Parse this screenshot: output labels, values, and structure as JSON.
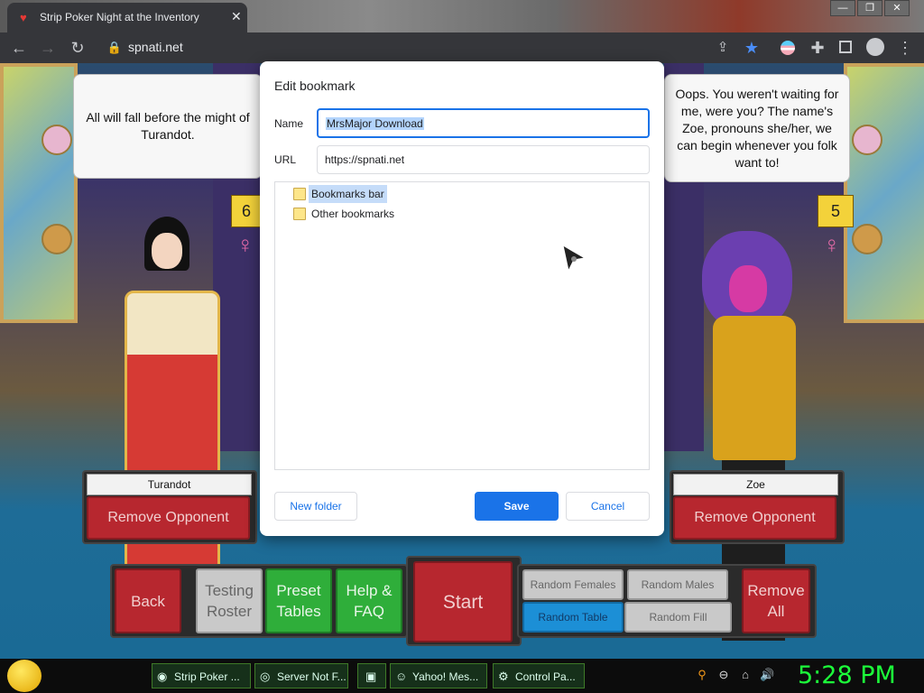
{
  "browser": {
    "tab_title": "Strip Poker Night at the Inventory",
    "tab_close": "✕",
    "url": "spnati.net",
    "window_controls": [
      "—",
      "❐",
      "✕"
    ]
  },
  "game": {
    "left_speech": "All will fall before the might of Turandot.",
    "right_speech": "Oops. You weren't waiting for me, were you? The name's Zoe, pronouns she/her, we can begin whenever you folk want to!",
    "left_badge": "6",
    "right_badge": "5",
    "left_name": "Turandot",
    "right_name": "Zoe",
    "remove_opponent": "Remove Opponent",
    "buttons": {
      "back": "Back",
      "testing_roster": "Testing Roster",
      "preset_tables": "Preset Tables",
      "help_faq": "Help & FAQ",
      "start": "Start",
      "random_females": "Random Females",
      "random_males": "Random Males",
      "random_table": "Random Table",
      "random_fill": "Random Fill",
      "remove_all": "Remove All"
    }
  },
  "dialog": {
    "title": "Edit bookmark",
    "name_label": "Name",
    "name_value": "MrsMajor Download",
    "url_label": "URL",
    "url_value": "https://spnati.net",
    "folders": [
      "Bookmarks bar",
      "Other bookmarks"
    ],
    "selected_folder": "Bookmarks bar",
    "new_folder": "New folder",
    "save": "Save",
    "cancel": "Cancel"
  },
  "taskbar": {
    "items": [
      "Strip Poker ...",
      "Server Not F...",
      "",
      "Yahoo! Mes...",
      "Control Pa..."
    ],
    "clock": "5:28 PM"
  },
  "colors": {
    "accent": "#1a73e8",
    "game_red": "#b7272f",
    "game_green": "#2fae3a",
    "game_blue": "#1c8fd6",
    "clock_green": "#1cff3a"
  }
}
